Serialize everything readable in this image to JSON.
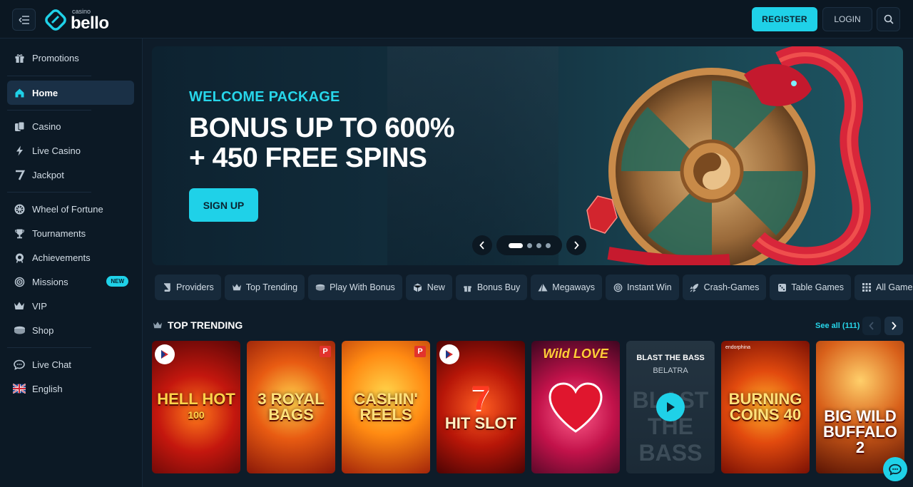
{
  "header": {
    "logo_small": "casino",
    "logo_big": "bello",
    "register_label": "REGISTER",
    "login_label": "LOGIN"
  },
  "sidebar": {
    "items": [
      {
        "label": "Promotions",
        "icon": "gift-icon"
      },
      {
        "label": "Home",
        "icon": "home-icon",
        "active": true
      },
      {
        "label": "Casino",
        "icon": "cards-icon"
      },
      {
        "label": "Live Casino",
        "icon": "lightning-icon"
      },
      {
        "label": "Jackpot",
        "icon": "seven-icon"
      },
      {
        "label": "Wheel of Fortune",
        "icon": "wheel-icon"
      },
      {
        "label": "Tournaments",
        "icon": "trophy-icon"
      },
      {
        "label": "Achievements",
        "icon": "medal-icon"
      },
      {
        "label": "Missions",
        "icon": "target-icon",
        "badge": "NEW"
      },
      {
        "label": "VIP",
        "icon": "crown-icon"
      },
      {
        "label": "Shop",
        "icon": "coins-icon"
      },
      {
        "label": "Live Chat",
        "icon": "chat-icon"
      },
      {
        "label": "English",
        "icon": "uk-flag-icon"
      }
    ]
  },
  "banner": {
    "subtitle": "WELCOME PACKAGE",
    "title_line1": "BONUS UP TO 600%",
    "title_line2": "+ 450 FREE SPINS",
    "cta_label": "SIGN UP",
    "slides": 4,
    "active_slide": 1
  },
  "categories": [
    {
      "label": "Providers",
      "icon": "book-icon"
    },
    {
      "label": "Top Trending",
      "icon": "crown-icon"
    },
    {
      "label": "Play With Bonus",
      "icon": "coins-icon"
    },
    {
      "label": "New",
      "icon": "cube-icon"
    },
    {
      "label": "Bonus Buy",
      "icon": "gift-icon"
    },
    {
      "label": "Megaways",
      "icon": "pyramid-icon"
    },
    {
      "label": "Instant Win",
      "icon": "target-icon"
    },
    {
      "label": "Crash-Games",
      "icon": "rocket-icon"
    },
    {
      "label": "Table Games",
      "icon": "dice-icon"
    },
    {
      "label": "All Games",
      "icon": "grid-icon"
    }
  ],
  "section": {
    "title": "TOP TRENDING",
    "see_all": "See all (111)"
  },
  "games": [
    {
      "line1": "HELL HOT",
      "line2": "100"
    },
    {
      "line1": "3 ROYAL",
      "line2": "BAGS"
    },
    {
      "line1": "CASHIN'",
      "line2": "REELS"
    },
    {
      "line1": "7",
      "line2": "HIT SLOT"
    },
    {
      "line1": "Wild LOVE",
      "line2": ""
    },
    {
      "line1": "BLAST THE BASS",
      "line2": "BELATRA",
      "bg": "BLAST THE BASS"
    },
    {
      "line1": "BURNING",
      "line2": "COINS 40",
      "provider": "endorphina"
    },
    {
      "line1": "BIG WILD",
      "line2": "BUFFALO 2"
    }
  ]
}
